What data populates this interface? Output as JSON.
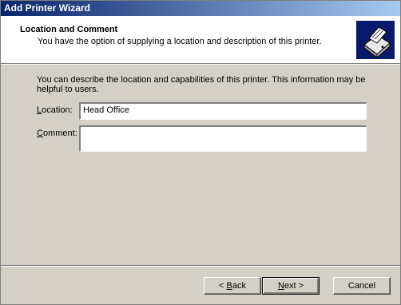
{
  "window": {
    "title": "Add Printer Wizard"
  },
  "header": {
    "title": "Location and Comment",
    "subtitle": "You have the option of supplying a location and description of this printer.",
    "icon": "printer-icon"
  },
  "body": {
    "description": "You can describe the location and capabilities of this printer. This information may be helpful to users.",
    "location": {
      "label_first": "L",
      "label_rest": "ocation:",
      "value": "Head Office"
    },
    "comment": {
      "label_first": "C",
      "label_rest": "omment:",
      "value": ""
    }
  },
  "buttons": {
    "back_prefix": "< ",
    "back_hot": "B",
    "back_rest": "ack",
    "next_hot": "N",
    "next_rest": "ext >",
    "cancel": "Cancel"
  }
}
